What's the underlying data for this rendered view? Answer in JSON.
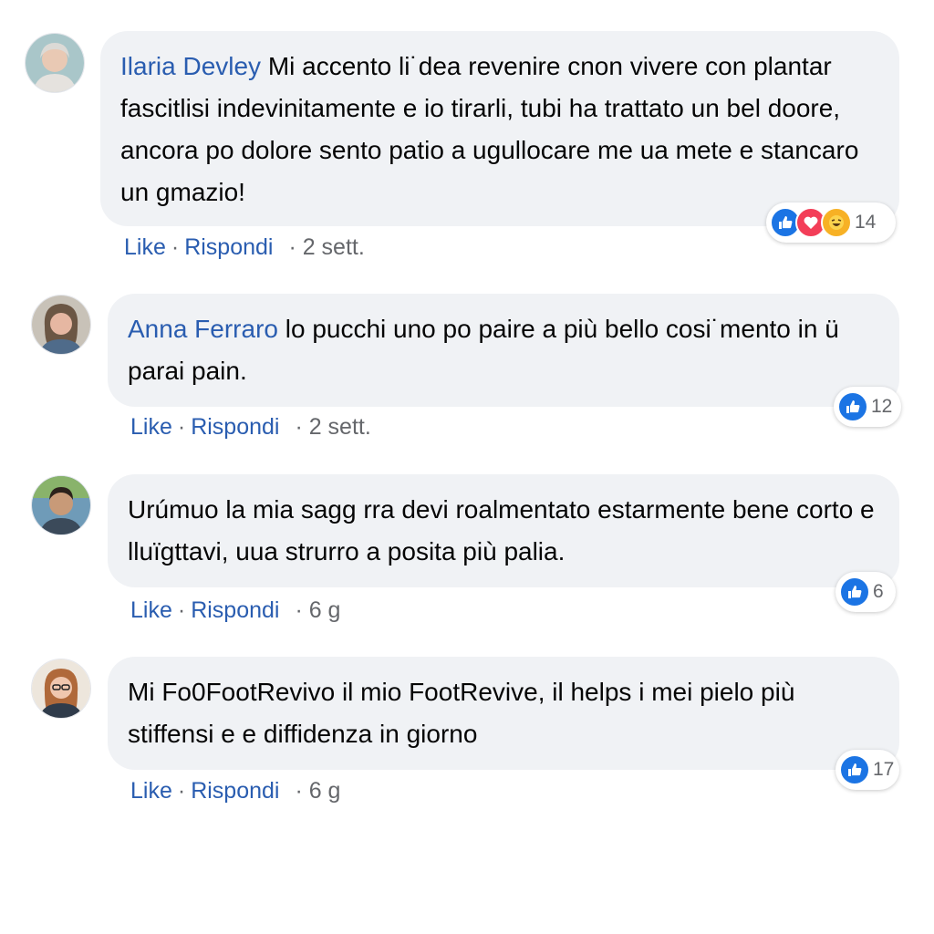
{
  "colors": {
    "link": "#2a5db0",
    "bubble": "#f0f2f5",
    "meta": "#65676b",
    "like": "#1b74e4",
    "love": "#f33e58",
    "haha": "#f7b125"
  },
  "comments": [
    {
      "author": "Ilaria Devley",
      "text": " Mi accento li˙dea revenire cnon vivere con plantar fascitlisi indevinitamente e io tirarli, tubi ha trattato un bel doore, ancora po dolore sento patio a ugullocare me ua mete e stancaro un gmazio!",
      "like": "Like",
      "reply": "Rispondi",
      "sep": "·",
      "time": "· 2 sett.",
      "reactions": [
        "thumbs-up-icon",
        "heart-icon",
        "haha-icon"
      ],
      "reaction_count": "14"
    },
    {
      "author": "Anna Ferraro",
      "text": " lo pucchi uno po paire a più bello cosi˙mento in ü parai pain.",
      "like": "Like",
      "reply": "Rispondi",
      "sep": "·",
      "time": "· 2 sett.",
      "reactions": [
        "thumbs-up-icon"
      ],
      "reaction_count": "12"
    },
    {
      "author": "",
      "text": "Urúmuo la mia sagg rra devi roalmentato estarmente bene corto e lluïgttavi, uua strurro a posita più palia.",
      "like": "Like",
      "reply": "Rispondi",
      "sep": "·",
      "time": "· 6 g",
      "reactions": [
        "thumbs-up-icon"
      ],
      "reaction_count": "6"
    },
    {
      "author": "",
      "text": "Mi Fo0FootRevivo il mio FootRevive, il helps i mei pielo più stiffensi e e diffidenza in giorno",
      "like": "Like",
      "reply": "Rispondi",
      "sep": "·",
      "time": "· 6 g",
      "reactions": [
        "thumbs-up-icon"
      ],
      "reaction_count": "17"
    }
  ]
}
